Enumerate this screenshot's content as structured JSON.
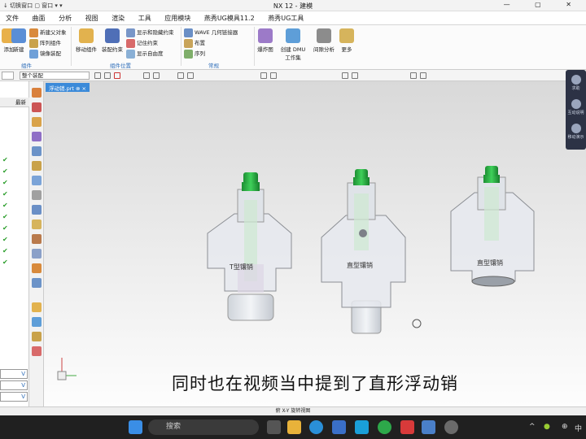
{
  "title": {
    "quick_access": "↓ 切换窗口 ▢ 窗口 ▾ ▾",
    "window": "NX 12 - 建模",
    "controls": "— ▢ ✕"
  },
  "menu": [
    "文件",
    "曲面",
    "分析",
    "视图",
    "渲染",
    "工具",
    "应用模块",
    "燕秀UG模具11.2",
    "燕秀UG工具"
  ],
  "ribbon": {
    "small_col1": [
      "新建父对象",
      "阵列组件",
      "镜像装配"
    ],
    "add": "添加",
    "new": "新建",
    "move": "移动组件",
    "constraint": "装配约束",
    "small_col2": [
      "显示和隐藏约束",
      "记住约束",
      "显示自由度"
    ],
    "small_col3": [
      "WAVE 几何链接器",
      "布置",
      "序列"
    ],
    "section": "爆炸图",
    "dmu": "创建 DMU",
    "dmu2": "工作集",
    "interference": "间隙分析",
    "more": "更多",
    "group_labels": [
      "组件",
      "组件位置",
      "常规"
    ]
  },
  "selbar": {
    "filter": "",
    "assembly": "整个装配"
  },
  "nav": {
    "header": "最新",
    "bottom_dd": [
      "V",
      "V",
      "V"
    ]
  },
  "viewport": {
    "tab": "浮动销.prt ⊗ ×"
  },
  "pins": [
    "T型镶销",
    "直型镶销",
    "直型镶销"
  ],
  "rpanel": [
    "求助",
    "互动说明",
    "移动演示"
  ],
  "caption": "同时也在视频当中提到了直形浮动销",
  "status": "俯 X-Y 旋转视图",
  "taskbar": {
    "search": "搜索",
    "tray_lang": "中"
  },
  "colors": {
    "accent": "#2c6cb8",
    "tip": "#1aa53a",
    "body": "#e6e9ee"
  }
}
